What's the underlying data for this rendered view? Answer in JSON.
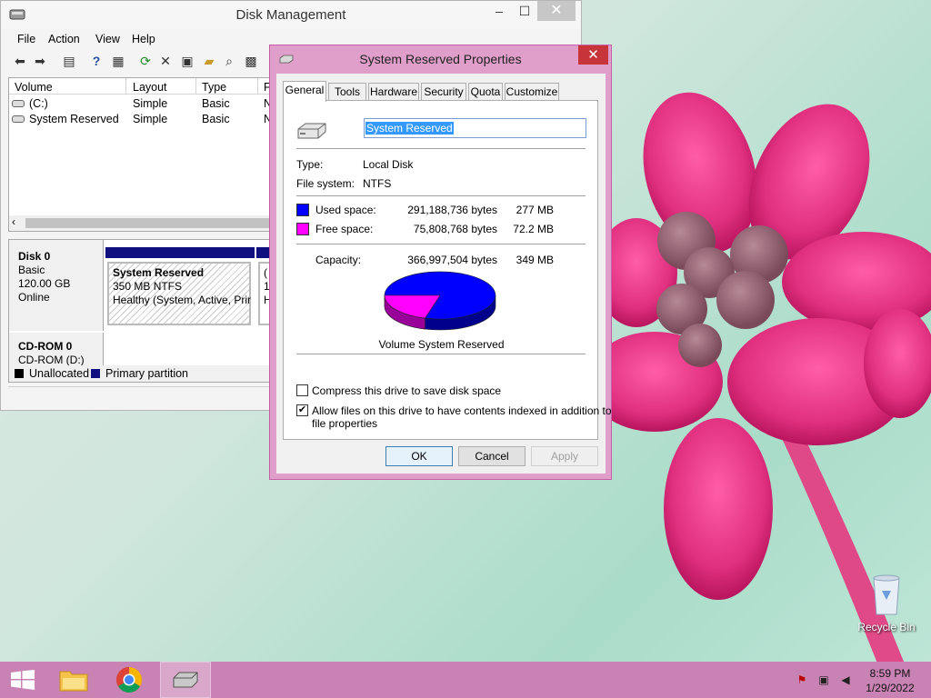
{
  "disk_management": {
    "title": "Disk Management",
    "menu": [
      "File",
      "Action",
      "View",
      "Help"
    ],
    "volume_columns": [
      "Volume",
      "Layout",
      "Type",
      "F"
    ],
    "volumes": [
      {
        "name": "(C:)",
        "layout": "Simple",
        "type": "Basic",
        "fs": "N"
      },
      {
        "name": "System Reserved",
        "layout": "Simple",
        "type": "Basic",
        "fs": "N"
      }
    ],
    "disk0": {
      "name": "Disk 0",
      "kind": "Basic",
      "size": "120.00 GB",
      "status": "Online"
    },
    "partition": {
      "name": "System Reserved",
      "size": "350 MB NTFS",
      "health": "Healthy (System, Active, Prir"
    },
    "partition2": {
      "letter": "(",
      "size": "11",
      "health": "H"
    },
    "cdrom": {
      "name": "CD-ROM 0",
      "drive": "CD-ROM (D:)"
    },
    "legend": {
      "unallocated": "Unallocated",
      "primary": "Primary partition",
      "unallocated_color": "#000000",
      "primary_color": "#0f0f80"
    }
  },
  "properties": {
    "title": "System Reserved Properties",
    "close": "✕",
    "tabs": [
      "General",
      "Tools",
      "Hardware",
      "Security",
      "Quota",
      "Customize"
    ],
    "active_tab": "General",
    "volume_name": "System Reserved",
    "type_label": "Type:",
    "type_value": "Local Disk",
    "fs_label": "File system:",
    "fs_value": "NTFS",
    "used_label": "Used space:",
    "used_bytes": "291,188,736 bytes",
    "used_size": "277 MB",
    "free_label": "Free space:",
    "free_bytes": "75,808,768 bytes",
    "free_size": "72.2 MB",
    "capacity_label": "Capacity:",
    "capacity_bytes": "366,997,504 bytes",
    "capacity_size": "349 MB",
    "used_color": "#0000ff",
    "free_color": "#ff00ff",
    "pie_caption": "Volume System Reserved",
    "compress_label": "Compress this drive to save disk space",
    "compress_checked": false,
    "index_label_1": "Allow files on this drive to have contents indexed in addition to",
    "index_label_2": "file properties",
    "index_checked": true,
    "ok": "OK",
    "cancel": "Cancel",
    "apply": "Apply"
  },
  "chart_data": {
    "type": "pie",
    "title": "Volume System Reserved",
    "labels": [
      "Used space",
      "Free space"
    ],
    "values": [
      291188736,
      75808768
    ],
    "colors": [
      "#0000ff",
      "#ff00ff"
    ]
  },
  "desktop": {
    "recycle_bin": "Recycle Bin"
  },
  "taskbar": {
    "time": "8:59 PM",
    "date": "1/29/2022"
  }
}
